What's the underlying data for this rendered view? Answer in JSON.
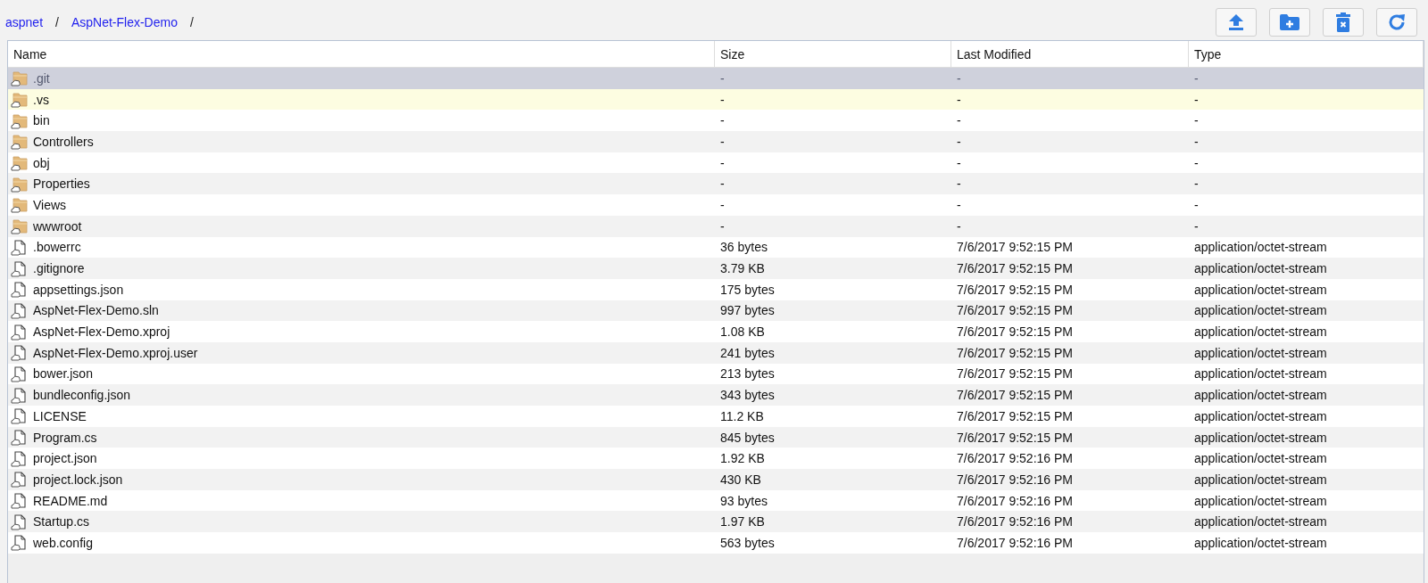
{
  "breadcrumb": [
    {
      "label": "aspnet",
      "kind": "link"
    },
    {
      "label": "/",
      "kind": "separator"
    },
    {
      "label": "AspNet-Flex-Demo",
      "kind": "link"
    },
    {
      "label": "/",
      "kind": "separator"
    }
  ],
  "toolbar": [
    {
      "kind": "upload"
    },
    {
      "kind": "new-folder"
    },
    {
      "kind": "delete"
    },
    {
      "kind": "refresh"
    }
  ],
  "table": {
    "columns": [
      "Name",
      "Size",
      "Last Modified",
      "Type"
    ],
    "rows": [
      {
        "kind": "folder",
        "name": ".git",
        "size": "-",
        "modified": "-",
        "type": "-",
        "selected": true,
        "highlighted": false
      },
      {
        "kind": "folder",
        "name": ".vs",
        "size": "-",
        "modified": "-",
        "type": "-",
        "selected": false,
        "highlighted": true
      },
      {
        "kind": "folder",
        "name": "bin",
        "size": "-",
        "modified": "-",
        "type": "-",
        "selected": false,
        "highlighted": false
      },
      {
        "kind": "folder",
        "name": "Controllers",
        "size": "-",
        "modified": "-",
        "type": "-",
        "selected": false,
        "highlighted": false
      },
      {
        "kind": "folder",
        "name": "obj",
        "size": "-",
        "modified": "-",
        "type": "-",
        "selected": false,
        "highlighted": false
      },
      {
        "kind": "folder",
        "name": "Properties",
        "size": "-",
        "modified": "-",
        "type": "-",
        "selected": false,
        "highlighted": false
      },
      {
        "kind": "folder",
        "name": "Views",
        "size": "-",
        "modified": "-",
        "type": "-",
        "selected": false,
        "highlighted": false
      },
      {
        "kind": "folder",
        "name": "wwwroot",
        "size": "-",
        "modified": "-",
        "type": "-",
        "selected": false,
        "highlighted": false
      },
      {
        "kind": "file",
        "name": ".bowerrc",
        "size": "36 bytes",
        "modified": "7/6/2017 9:52:15 PM",
        "type": "application/octet-stream",
        "selected": false,
        "highlighted": false
      },
      {
        "kind": "file",
        "name": ".gitignore",
        "size": "3.79 KB",
        "modified": "7/6/2017 9:52:15 PM",
        "type": "application/octet-stream",
        "selected": false,
        "highlighted": false
      },
      {
        "kind": "file",
        "name": "appsettings.json",
        "size": "175 bytes",
        "modified": "7/6/2017 9:52:15 PM",
        "type": "application/octet-stream",
        "selected": false,
        "highlighted": false
      },
      {
        "kind": "file",
        "name": "AspNet-Flex-Demo.sln",
        "size": "997 bytes",
        "modified": "7/6/2017 9:52:15 PM",
        "type": "application/octet-stream",
        "selected": false,
        "highlighted": false
      },
      {
        "kind": "file",
        "name": "AspNet-Flex-Demo.xproj",
        "size": "1.08 KB",
        "modified": "7/6/2017 9:52:15 PM",
        "type": "application/octet-stream",
        "selected": false,
        "highlighted": false
      },
      {
        "kind": "file",
        "name": "AspNet-Flex-Demo.xproj.user",
        "size": "241 bytes",
        "modified": "7/6/2017 9:52:15 PM",
        "type": "application/octet-stream",
        "selected": false,
        "highlighted": false
      },
      {
        "kind": "file",
        "name": "bower.json",
        "size": "213 bytes",
        "modified": "7/6/2017 9:52:15 PM",
        "type": "application/octet-stream",
        "selected": false,
        "highlighted": false
      },
      {
        "kind": "file",
        "name": "bundleconfig.json",
        "size": "343 bytes",
        "modified": "7/6/2017 9:52:15 PM",
        "type": "application/octet-stream",
        "selected": false,
        "highlighted": false
      },
      {
        "kind": "file",
        "name": "LICENSE",
        "size": "11.2 KB",
        "modified": "7/6/2017 9:52:15 PM",
        "type": "application/octet-stream",
        "selected": false,
        "highlighted": false
      },
      {
        "kind": "file",
        "name": "Program.cs",
        "size": "845 bytes",
        "modified": "7/6/2017 9:52:15 PM",
        "type": "application/octet-stream",
        "selected": false,
        "highlighted": false
      },
      {
        "kind": "file",
        "name": "project.json",
        "size": "1.92 KB",
        "modified": "7/6/2017 9:52:16 PM",
        "type": "application/octet-stream",
        "selected": false,
        "highlighted": false
      },
      {
        "kind": "file",
        "name": "project.lock.json",
        "size": "430 KB",
        "modified": "7/6/2017 9:52:16 PM",
        "type": "application/octet-stream",
        "selected": false,
        "highlighted": false
      },
      {
        "kind": "file",
        "name": "README.md",
        "size": "93 bytes",
        "modified": "7/6/2017 9:52:16 PM",
        "type": "application/octet-stream",
        "selected": false,
        "highlighted": false
      },
      {
        "kind": "file",
        "name": "Startup.cs",
        "size": "1.97 KB",
        "modified": "7/6/2017 9:52:16 PM",
        "type": "application/octet-stream",
        "selected": false,
        "highlighted": false
      },
      {
        "kind": "file",
        "name": "web.config",
        "size": "563 bytes",
        "modified": "7/6/2017 9:52:16 PM",
        "type": "application/octet-stream",
        "selected": false,
        "highlighted": false
      }
    ]
  }
}
